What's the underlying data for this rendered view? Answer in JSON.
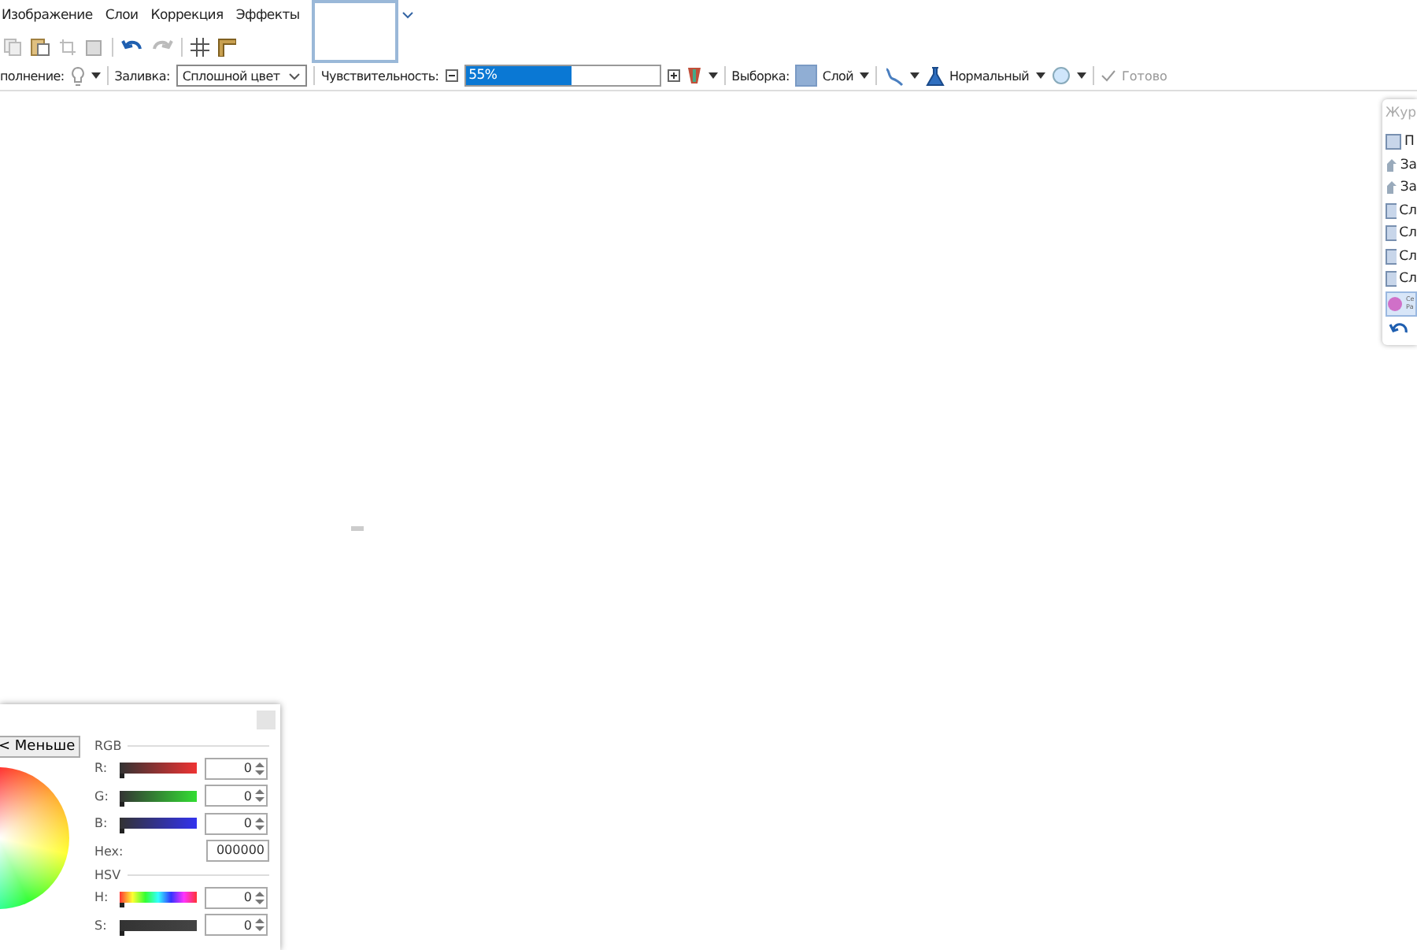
{
  "menu": [
    "Изображение",
    "Слои",
    "Коррекция",
    "Эффекты"
  ],
  "options": {
    "antialias_label": "полнение:",
    "fill_label": "Заливка:",
    "fill_value": "Сплошной цвет",
    "tolerance_label": "Чувствительность:",
    "tolerance": {
      "reading": "55%",
      "level": 0.55
    },
    "sampling_label": "Выборка:",
    "sampling_value": "Слой",
    "blend_value": "Нормальный",
    "done": {
      "label": "Готово",
      "disabled": true
    }
  },
  "history": {
    "title": "Жур",
    "items": [
      {
        "kind": "layer",
        "label": "П",
        "selected": false
      },
      {
        "kind": "move",
        "label": "За",
        "selected": false
      },
      {
        "kind": "move",
        "label": "За",
        "selected": false
      },
      {
        "kind": "layer",
        "label": "Сл",
        "selected": false
      },
      {
        "kind": "layer",
        "label": "Сл",
        "selected": false
      },
      {
        "kind": "layer",
        "label": "Сл",
        "selected": false
      },
      {
        "kind": "layer",
        "label": "Сл",
        "selected": false
      },
      {
        "kind": "effect",
        "label": "Се",
        "label2": "Ра",
        "selected": true
      }
    ]
  },
  "colors": {
    "less_button": "< Меньше",
    "rgb_title": "RGB",
    "hsv_title": "HSV",
    "hex_label": "Hex:",
    "hex_value": "000000",
    "rows": [
      {
        "kind": "r",
        "label": "R:",
        "value": "0",
        "level": 0
      },
      {
        "kind": "g",
        "label": "G:",
        "value": "0",
        "level": 0
      },
      {
        "kind": "b",
        "label": "B:",
        "value": "0",
        "level": 0
      },
      {
        "kind": "hex"
      },
      {
        "kind": "h",
        "label": "H:",
        "value": "0",
        "level": 0
      },
      {
        "kind": "s",
        "label": "S:",
        "value": "0",
        "level": 0
      }
    ]
  }
}
